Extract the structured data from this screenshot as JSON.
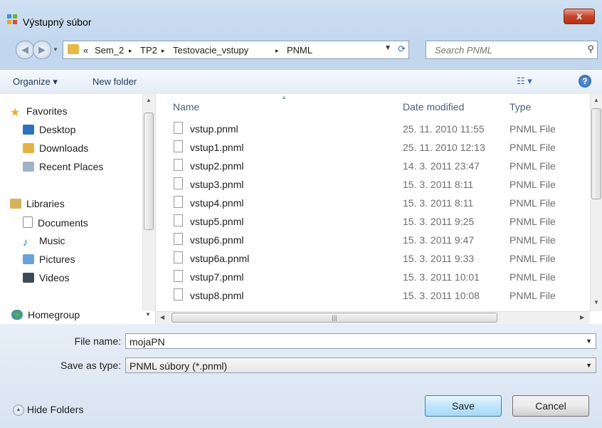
{
  "window": {
    "title": "Výstupný súbor",
    "close_label": "x"
  },
  "address": {
    "overflow": "«",
    "crumbs": [
      "Sem_2",
      "TP2",
      "Testovacie_vstupy",
      "PNML"
    ],
    "separator": "▸",
    "search_placeholder": "Search PNML"
  },
  "toolbar": {
    "organize_label": "Organize ▾",
    "new_folder_label": "New folder"
  },
  "nav": {
    "favorites_label": "Favorites",
    "favorites": [
      "Desktop",
      "Downloads",
      "Recent Places"
    ],
    "libraries_label": "Libraries",
    "libraries": [
      "Documents",
      "Music",
      "Pictures",
      "Videos"
    ],
    "homegroup_label": "Homegroup"
  },
  "files": {
    "columns": {
      "name": "Name",
      "date": "Date modified",
      "type": "Type"
    },
    "rows": [
      {
        "name": "vstup.pnml",
        "date": "25. 11. 2010 11:55",
        "type": "PNML File"
      },
      {
        "name": "vstup1.pnml",
        "date": "25. 11. 2010 12:13",
        "type": "PNML File"
      },
      {
        "name": "vstup2.pnml",
        "date": "14. 3. 2011 23:47",
        "type": "PNML File"
      },
      {
        "name": "vstup3.pnml",
        "date": "15. 3. 2011 8:11",
        "type": "PNML File"
      },
      {
        "name": "vstup4.pnml",
        "date": "15. 3. 2011 8:11",
        "type": "PNML File"
      },
      {
        "name": "vstup5.pnml",
        "date": "15. 3. 2011 9:25",
        "type": "PNML File"
      },
      {
        "name": "vstup6.pnml",
        "date": "15. 3. 2011 9:47",
        "type": "PNML File"
      },
      {
        "name": "vstup6a.pnml",
        "date": "15. 3. 2011 9:33",
        "type": "PNML File"
      },
      {
        "name": "vstup7.pnml",
        "date": "15. 3. 2011 10:01",
        "type": "PNML File"
      },
      {
        "name": "vstup8.pnml",
        "date": "15. 3. 2011 10:08",
        "type": "PNML File"
      }
    ]
  },
  "form": {
    "file_name_label": "File name:",
    "file_name_value": "mojaPN",
    "save_type_label": "Save as type:",
    "save_type_value": "PNML súbory (*.pnml)"
  },
  "footer": {
    "hide_folders_label": "Hide Folders",
    "save_label": "Save",
    "cancel_label": "Cancel"
  }
}
